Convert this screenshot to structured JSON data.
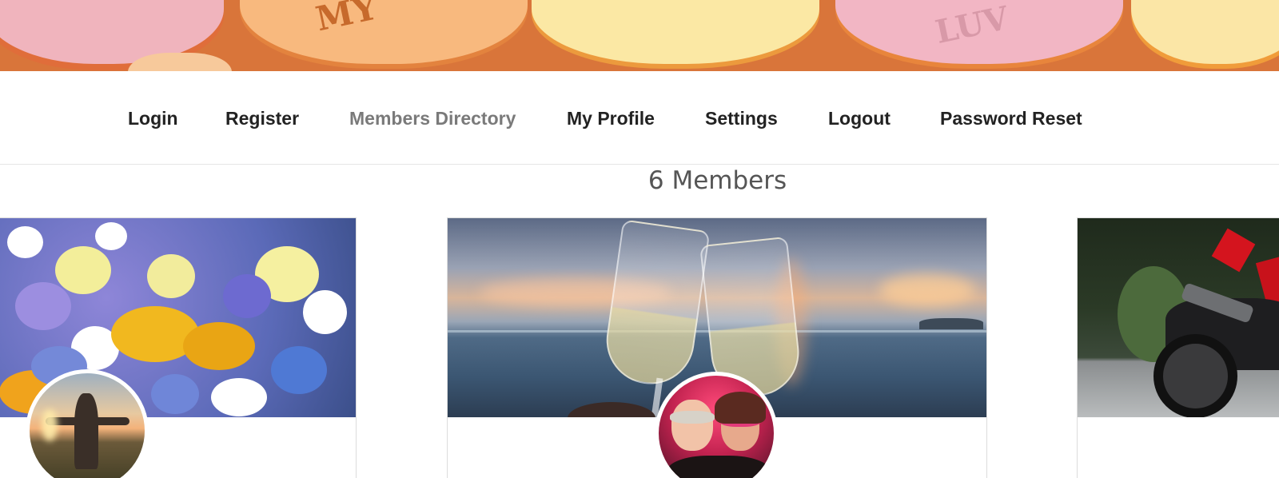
{
  "nav": {
    "items": [
      {
        "label": "Login"
      },
      {
        "label": "Register"
      },
      {
        "label": "Members Directory"
      },
      {
        "label": "My Profile"
      },
      {
        "label": "Settings"
      },
      {
        "label": "Logout"
      },
      {
        "label": "Password Reset"
      }
    ],
    "active": "Members Directory"
  },
  "directory": {
    "count_text": "6 Members"
  },
  "banner": {
    "engraving_1": "MY",
    "engraving_2": "LUV"
  },
  "colors": {
    "nav_text": "#222222",
    "nav_active": "#7a7a7a",
    "count_text": "#555555"
  }
}
